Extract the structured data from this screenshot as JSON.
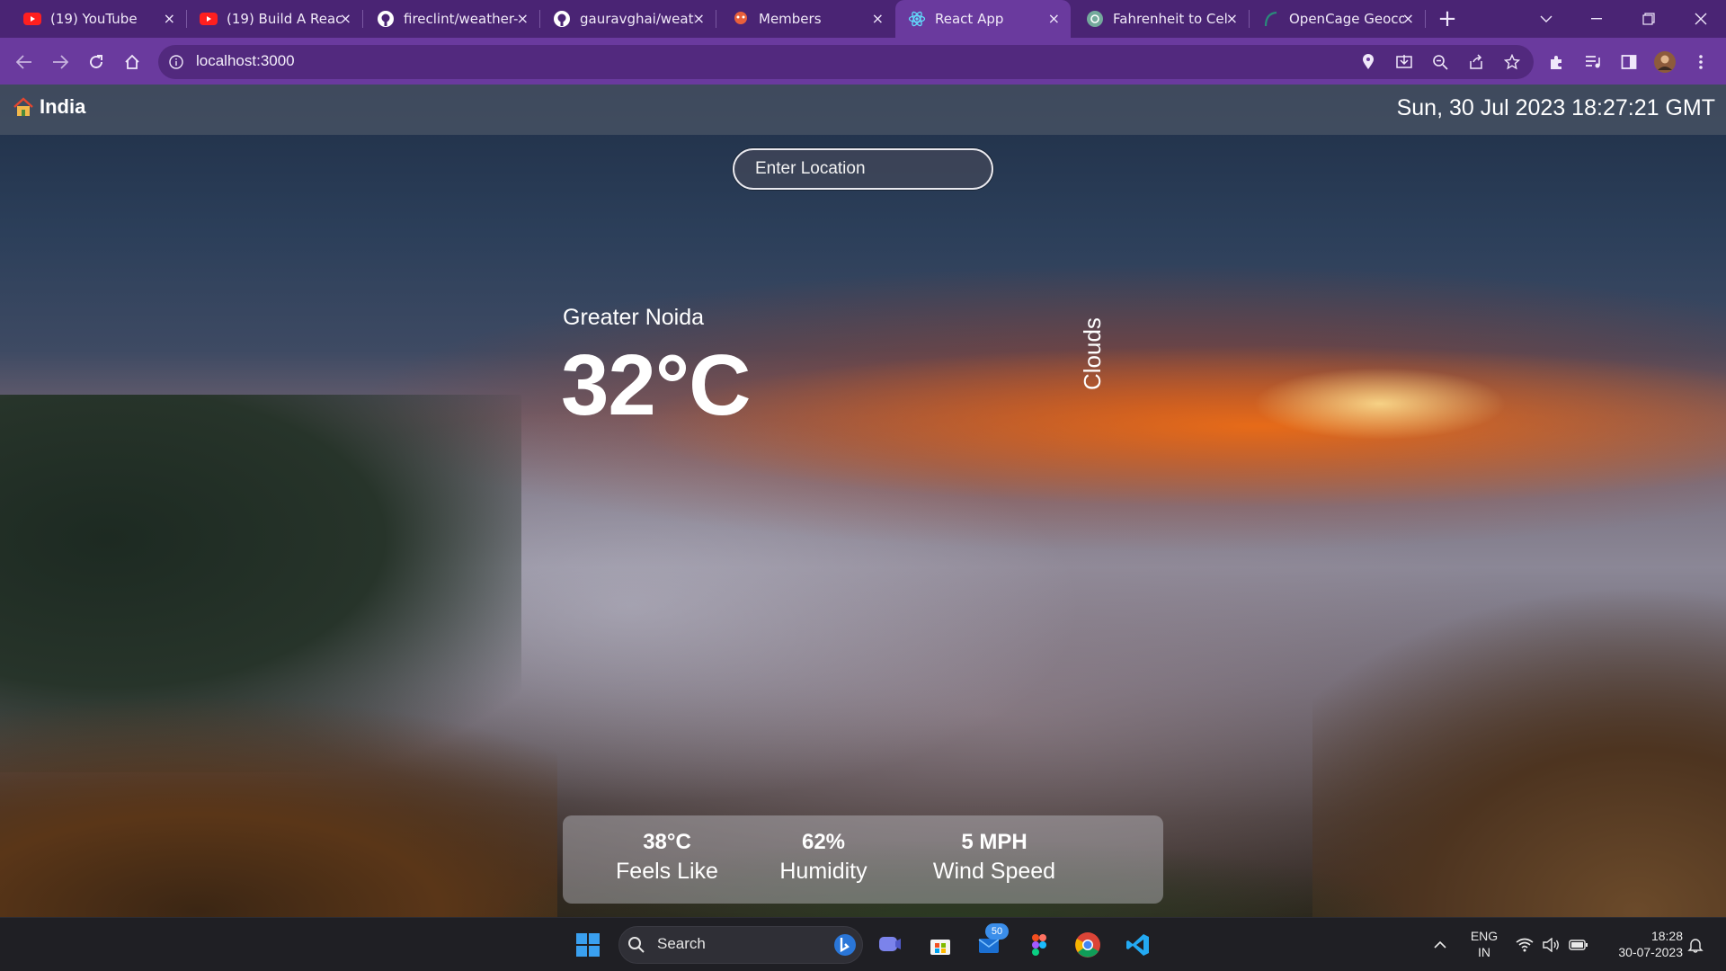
{
  "browser": {
    "tabs": [
      {
        "title": "(19) YouTube",
        "icon": "youtube-icon"
      },
      {
        "title": "(19) Build A React",
        "icon": "youtube-icon"
      },
      {
        "title": "fireclint/weather-",
        "icon": "github-icon"
      },
      {
        "title": "gauravghai/weatl",
        "icon": "github-icon"
      },
      {
        "title": "Members",
        "icon": "members-icon"
      },
      {
        "title": "React App",
        "icon": "react-icon",
        "active": true
      },
      {
        "title": "Fahrenheit to Cel",
        "icon": "chatgpt-icon"
      },
      {
        "title": "OpenCage Geoco",
        "icon": "opencage-icon"
      }
    ],
    "url": "localhost:3000",
    "new_tab": "+",
    "close_glyph": "×"
  },
  "app": {
    "country": "India",
    "datetime": "Sun, 30 Jul 2023 18:27:21 GMT",
    "search_placeholder": "Enter Location",
    "city": "Greater Noida",
    "temperature": "32°C",
    "condition": "Clouds",
    "stats": [
      {
        "value": "38°C",
        "label": "Feels Like"
      },
      {
        "value": "62%",
        "label": "Humidity"
      },
      {
        "value": "5 MPH",
        "label": "Wind Speed"
      }
    ]
  },
  "taskbar": {
    "search_label": "Search",
    "mail_badge": "50",
    "lang": "ENG",
    "region": "IN",
    "time": "18:28",
    "date": "30-07-2023"
  },
  "colors": {
    "tabbar": "#4a2474",
    "toolbar": "#6a3a9e",
    "taskbar": "#1f1f24"
  }
}
